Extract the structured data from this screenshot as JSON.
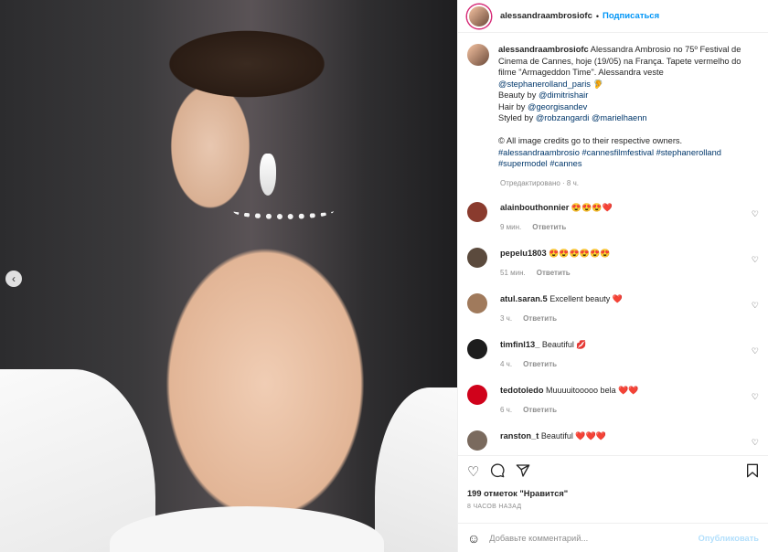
{
  "post": {
    "username": "alessandraambrosiofc",
    "follow_label": "Подписаться",
    "more_label": "···",
    "carousel_prev": "‹"
  },
  "caption": {
    "username": "alessandraambrosiofc",
    "line1": " Alessandra Ambrosio no 75º Festival de Cinema de Cannes, hoje (19/05) na França. Tapete vermelho do filme \"Armageddon Time\". Alessandra veste ",
    "mention1": "@stephanerolland_paris",
    "emoji1": " 🦻",
    "beauty_prefix": "Beauty by ",
    "beauty_link": "@dimitrishair",
    "hair_prefix": "Hair by ",
    "hair_link": "@georgisandev",
    "styled_prefix": "Styled by ",
    "styled_link1": "@robzangardi",
    "styled_link2": "@marielhaenn",
    "credits": "© All image credits go to their respective owners.",
    "hashtags1": "#alessandraambrosio #cannesfilmfestival #stephanerolland",
    "hashtags2": "#supermodel #cannes",
    "time": "Отредактировано · 8 ч."
  },
  "comments": [
    {
      "user": "alainbouthonnier",
      "text": " 😍😍😍❤️",
      "time": "9 мин.",
      "reply": "Ответить",
      "avatar_color": "#8a3b2e"
    },
    {
      "user": "pepelu1803",
      "text": " 😍😍😍😍😍😍",
      "time": "51 мин.",
      "reply": "Ответить",
      "avatar_color": "#5b4a3d"
    },
    {
      "user": "atul.saran.5",
      "text": " Excellent beauty ❤️",
      "time": "3 ч.",
      "reply": "Ответить",
      "avatar_color": "#a07a5c"
    },
    {
      "user": "timfinl13_",
      "text": " Beautiful 💋",
      "time": "4 ч.",
      "reply": "Ответить",
      "avatar_color": "#1d1d1d"
    },
    {
      "user": "tedotoledo",
      "text": " Muuuuitooooo bela ❤️❤️",
      "time": "6 ч.",
      "reply": "Ответить",
      "avatar_color": "#d0021b"
    },
    {
      "user": "ranston_t",
      "text": " Beautiful ❤️❤️❤️",
      "time": "",
      "reply": "",
      "avatar_color": "#7a6a5e"
    }
  ],
  "actions": {
    "likes": "199 отметок \"Нравится\"",
    "post_time": "8 ЧАСОВ НАЗАД"
  },
  "add_comment": {
    "placeholder": "Добавьте комментарий...",
    "publish_label": "Опубликовать"
  }
}
